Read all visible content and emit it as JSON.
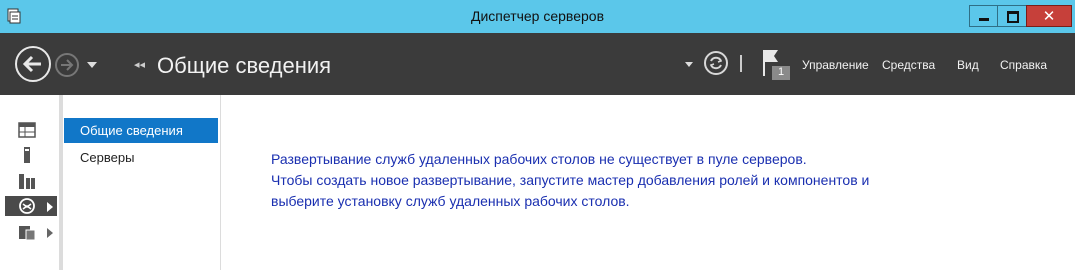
{
  "window": {
    "title": "Диспетчер серверов",
    "close_glyph": "✕"
  },
  "toolbar": {
    "page_title": "Общие сведения",
    "breadcrumb_glyph": "◂◂",
    "notification_count": "1",
    "menu": [
      "Управление",
      "Средства",
      "Вид",
      "Справка"
    ]
  },
  "nav": {
    "items": [
      {
        "label": "Общие сведения",
        "active": true
      },
      {
        "label": "Серверы",
        "active": false
      }
    ]
  },
  "sidebar_icons": [
    "dashboard-icon",
    "local-server-icon",
    "all-servers-icon",
    "remote-desktop-icon",
    "file-storage-icon"
  ],
  "message": {
    "lines": [
      "Развертывание служб удаленных рабочих столов не существует в пуле серверов.",
      "Чтобы создать новое развертывание, запустите мастер добавления ролей и компонентов и",
      "выберите установку служб удаленных рабочих столов."
    ]
  },
  "colors": {
    "titlebar": "#5bc7ea",
    "toolbar": "#3b3b3b",
    "accent": "#1177c8",
    "message_text": "#1a2fb0",
    "close_button": "#c6403a"
  }
}
